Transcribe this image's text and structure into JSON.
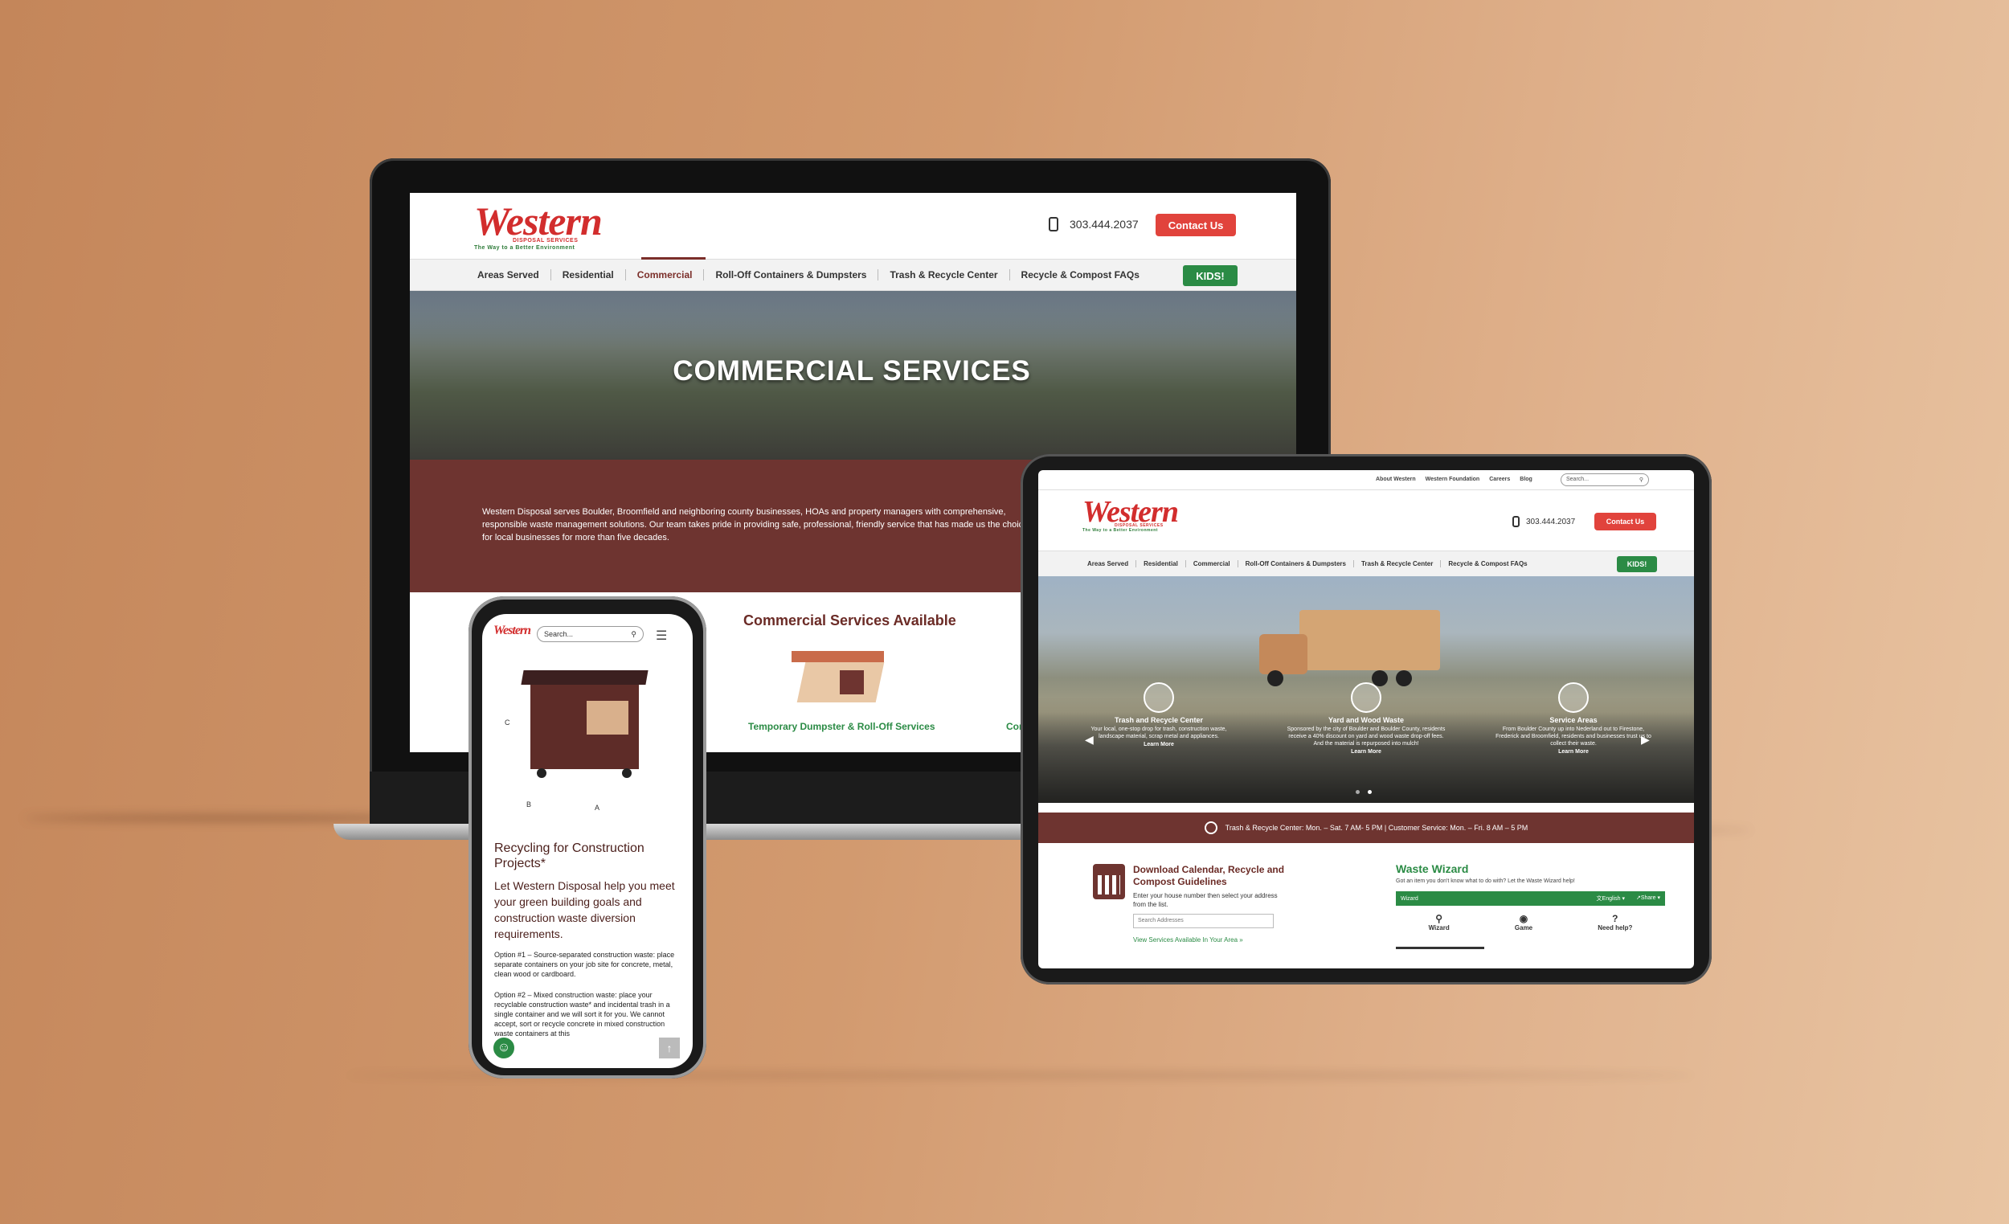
{
  "colors": {
    "brand_red": "#e1433c",
    "brand_brown": "#6e3430",
    "brand_green": "#2b8b45"
  },
  "brand": {
    "logo": "Western",
    "logo_sub": "DISPOSAL SERVICES",
    "tagline": "The Way to a Better Environment"
  },
  "laptop": {
    "phone": "303.444.2037",
    "contact_label": "Contact Us",
    "nav": [
      "Areas Served",
      "Residential",
      "Commercial",
      "Roll-Off Containers & Dumpsters",
      "Trash & Recycle Center",
      "Recycle & Compost FAQs"
    ],
    "kids_label": "KIDS!",
    "hero_title": "COMMERCIAL SERVICES",
    "intro": "Western Disposal serves Boulder, Broomfield and neighboring county businesses, HOAs and property managers with comprehensive, responsible waste management solutions. Our team takes pride in providing safe, professional, friendly service that has made us the choice for local businesses for more than five decades.",
    "services_heading": "Commercial Services Available",
    "service_1": "Temporary Dumpster & Roll-Off Services",
    "service_2_partial": "Com"
  },
  "tablet": {
    "top_links": [
      "About Western",
      "Western Foundation",
      "Careers",
      "Blog"
    ],
    "search_placeholder": "Search...",
    "phone": "303.444.2037",
    "contact_label": "Contact Us",
    "nav": [
      "Areas Served",
      "Residential",
      "Commercial",
      "Roll-Off Containers & Dumpsters",
      "Trash & Recycle Center",
      "Recycle & Compost FAQs"
    ],
    "kids_label": "KIDS!",
    "features": [
      {
        "title": "Trash and Recycle Center",
        "text": "Your local, one-stop drop for trash, construction waste, landscape material, scrap metal and appliances.",
        "link": "Learn More"
      },
      {
        "title": "Yard and Wood Waste",
        "text": "Sponsored by the city of Boulder and Boulder County, residents receive a 40% discount on yard and wood waste drop-off fees. And the material is repurposed into mulch!",
        "link": "Learn More"
      },
      {
        "title": "Service Areas",
        "text": "From Boulder County up into Nederland out to Firestone, Frederick and Broomfield, residents and businesses trust us to collect their waste.",
        "link": "Learn More"
      }
    ],
    "hours": "Trash & Recycle Center: Mon. – Sat. 7 AM- 5 PM | Customer Service: Mon. – Fri. 8 AM – 5 PM",
    "calendar_title": "Download Calendar, Recycle and Compost Guidelines",
    "calendar_text": "Enter your house number then select your address from the list.",
    "address_placeholder": "Search Addresses",
    "services_link": "View Services Available In Your Area »",
    "wizard_title": "Waste Wizard",
    "wizard_text": "Got an item you don't know what to do with? Let the Waste Wizard help!",
    "wizard_bar": "Wizard",
    "wizard_lang": "English",
    "wizard_share": "Share",
    "wizard_tabs": [
      "Wizard",
      "Game",
      "Need help?"
    ]
  },
  "phone": {
    "search_placeholder": "Search...",
    "dims": [
      "C",
      "B",
      "A"
    ],
    "heading": "Recycling for Construction Projects*",
    "lead": "Let Western Disposal help you meet your green building goals and construction waste diversion requirements.",
    "option1": "Option #1 – Source-separated construction waste: place separate containers on your job site for concrete, metal, clean wood or cardboard.",
    "option2": "Option #2 – Mixed construction waste: place your recyclable construction waste* and incidental trash in a single container and we will sort it for you. We cannot accept, sort or recycle concrete in mixed construction waste containers at this"
  }
}
